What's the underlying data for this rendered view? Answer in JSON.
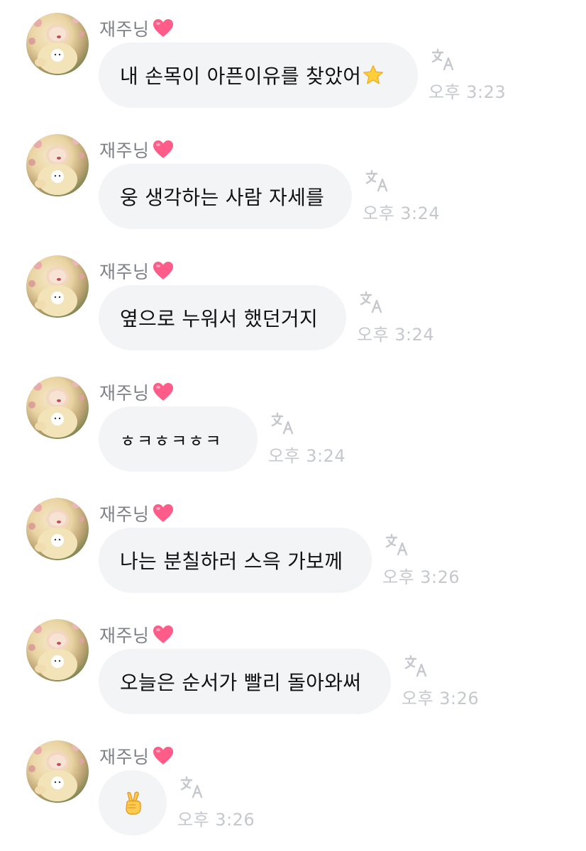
{
  "colors": {
    "bubble_bg": "#f3f4f6",
    "sender_name": "#7d8187",
    "timestamp": "#c5c8cc",
    "heart": "#ff5c8a",
    "translate_icon": "#c5c8cc"
  },
  "messages": [
    {
      "sender": "재주닝",
      "sender_emoji": "heart-icon",
      "text": "내 손목이 아픈이유를 찾았어",
      "emoji": "star-icon",
      "time": "오후 3:23",
      "translate_icon": "translate-icon"
    },
    {
      "sender": "재주닝",
      "sender_emoji": "heart-icon",
      "text": "웅 생각하는 사람 자세를",
      "time": "오후 3:24",
      "translate_icon": "translate-icon"
    },
    {
      "sender": "재주닝",
      "sender_emoji": "heart-icon",
      "text": "옆으로 누워서 했던거지",
      "time": "오후 3:24",
      "translate_icon": "translate-icon"
    },
    {
      "sender": "재주닝",
      "sender_emoji": "heart-icon",
      "text": "ㅎㅋㅎㅋㅎㅋ",
      "time": "오후 3:24",
      "translate_icon": "translate-icon"
    },
    {
      "sender": "재주닝",
      "sender_emoji": "heart-icon",
      "text": "나는 분칠하러 스윽 가보께",
      "time": "오후 3:26",
      "translate_icon": "translate-icon"
    },
    {
      "sender": "재주닝",
      "sender_emoji": "heart-icon",
      "text": "오늘은 순서가 빨리 돌아와써",
      "time": "오후 3:26",
      "translate_icon": "translate-icon"
    },
    {
      "sender": "재주닝",
      "sender_emoji": "heart-icon",
      "text": "",
      "emoji": "victory-hand-icon",
      "time": "오후 3:26",
      "translate_icon": "translate-icon"
    }
  ]
}
